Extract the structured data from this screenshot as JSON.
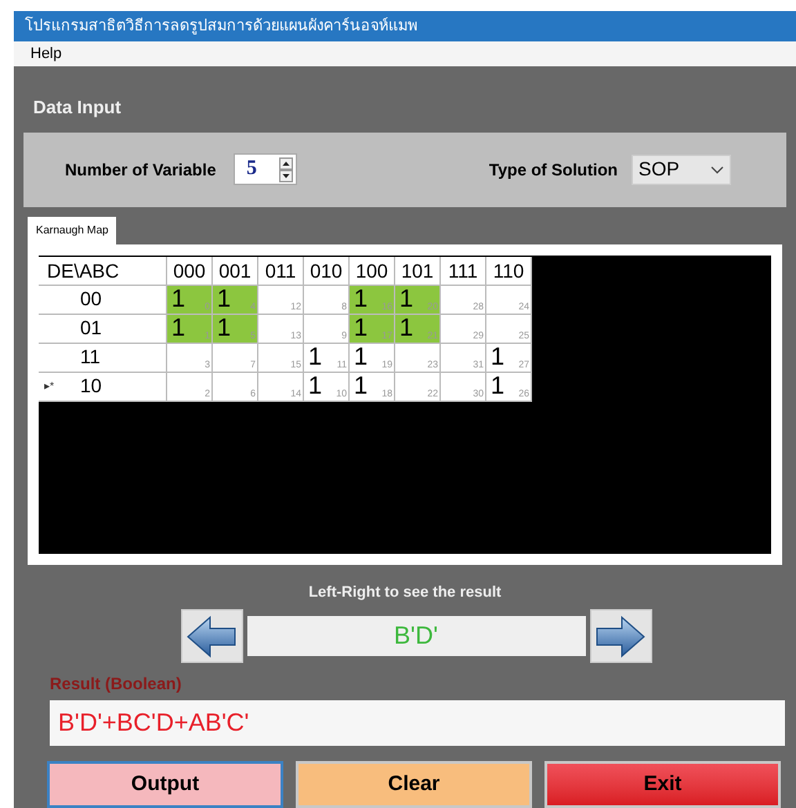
{
  "window": {
    "title": "โปรแกรมสาธิตวิธีการลดรูปสมการด้วยแผนผังคาร์นอจห์แมพ"
  },
  "menu": [
    "Help"
  ],
  "data_input": {
    "heading": "Data Input",
    "variables_label": "Number of Variable",
    "variables_value": "5",
    "solution_label": "Type of Solution",
    "solution_value": "SOP"
  },
  "tabs": [
    {
      "label": "Karnaugh Map",
      "selected": true
    }
  ],
  "kmap": {
    "corner": "DE\\ABC",
    "columns": [
      "000",
      "001",
      "011",
      "010",
      "100",
      "101",
      "111",
      "110"
    ],
    "rows": [
      {
        "header": "00",
        "cells": [
          {
            "value": "1",
            "index": "0",
            "selected": true
          },
          {
            "value": "1",
            "index": "4",
            "selected": true
          },
          {
            "index": "12",
            "selected": false
          },
          {
            "index": "8",
            "selected": false
          },
          {
            "value": "1",
            "index": "16",
            "selected": true
          },
          {
            "value": "1",
            "index": "20",
            "selected": true
          },
          {
            "index": "28",
            "selected": false
          },
          {
            "index": "24",
            "selected": false
          }
        ]
      },
      {
        "header": "01",
        "cells": [
          {
            "value": "1",
            "index": "1",
            "selected": true
          },
          {
            "value": "1",
            "index": "5",
            "selected": true
          },
          {
            "index": "13",
            "selected": false
          },
          {
            "index": "9",
            "selected": false
          },
          {
            "value": "1",
            "index": "17",
            "selected": true
          },
          {
            "value": "1",
            "index": "21",
            "selected": true
          },
          {
            "index": "29",
            "selected": false
          },
          {
            "index": "25",
            "selected": false
          }
        ]
      },
      {
        "header": "11",
        "cells": [
          {
            "index": "3",
            "selected": false
          },
          {
            "index": "7",
            "selected": false
          },
          {
            "index": "15",
            "selected": false
          },
          {
            "value": "1",
            "index": "11",
            "selected": false
          },
          {
            "value": "1",
            "index": "19",
            "selected": false
          },
          {
            "index": "23",
            "selected": false
          },
          {
            "index": "31",
            "selected": false
          },
          {
            "value": "1",
            "index": "27",
            "selected": false
          }
        ]
      },
      {
        "header": "10",
        "marker": "▸*",
        "cells": [
          {
            "index": "2",
            "selected": false
          },
          {
            "index": "6",
            "selected": false
          },
          {
            "index": "14",
            "selected": false
          },
          {
            "value": "1",
            "index": "10",
            "selected": false
          },
          {
            "value": "1",
            "index": "18",
            "selected": false
          },
          {
            "index": "22",
            "selected": false
          },
          {
            "index": "30",
            "selected": false
          },
          {
            "value": "1",
            "index": "26",
            "selected": false
          }
        ]
      }
    ]
  },
  "navigator": {
    "hint": "Left-Right to see the result",
    "term": "B'D'"
  },
  "result": {
    "label": "Result (Boolean)",
    "value": "B'D'+BC'D+AB'C'"
  },
  "buttons": [
    {
      "label": "Output",
      "kind": "output"
    },
    {
      "label": "Clear",
      "kind": "clear"
    },
    {
      "label": "Exit",
      "kind": "exit"
    }
  ]
}
